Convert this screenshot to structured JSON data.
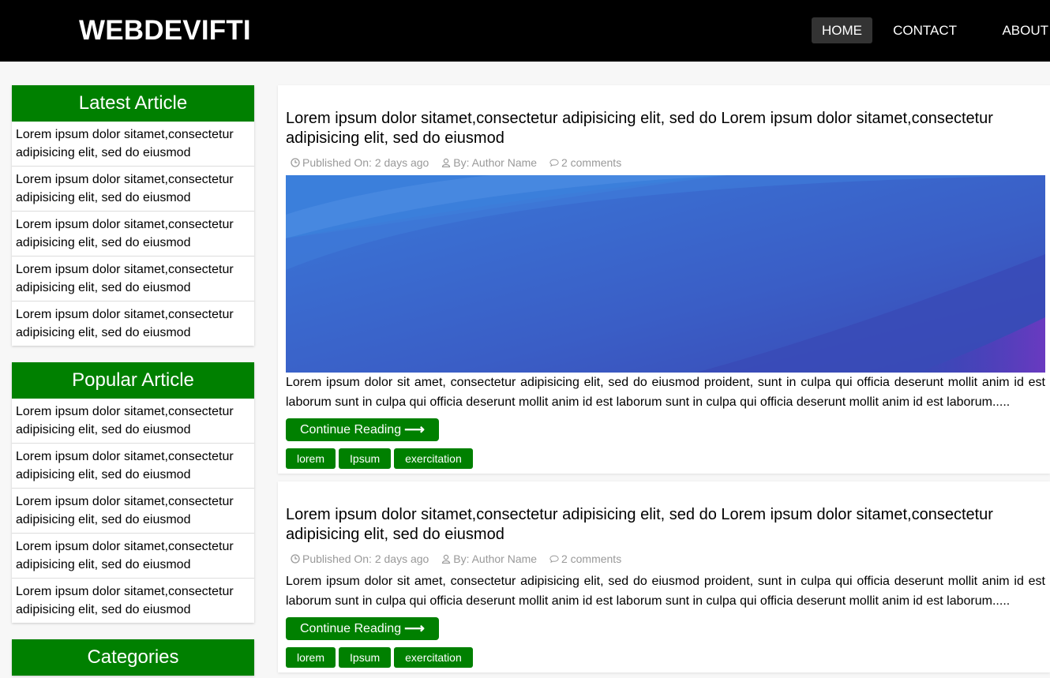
{
  "header": {
    "logo": "WEBDEVIFTI",
    "nav": [
      {
        "label": "HOME",
        "active": true
      },
      {
        "label": "CONTACT",
        "active": false
      },
      {
        "label": "ABOUT",
        "active": false
      }
    ]
  },
  "sidebar": {
    "latest": {
      "title": "Latest Article",
      "items": [
        "Lorem ipsum dolor sitamet,consectetur adipisicing elit, sed do eiusmod",
        "Lorem ipsum dolor sitamet,consectetur adipisicing elit, sed do eiusmod",
        "Lorem ipsum dolor sitamet,consectetur adipisicing elit, sed do eiusmod",
        "Lorem ipsum dolor sitamet,consectetur adipisicing elit, sed do eiusmod",
        "Lorem ipsum dolor sitamet,consectetur adipisicing elit, sed do eiusmod"
      ]
    },
    "popular": {
      "title": "Popular Article",
      "items": [
        "Lorem ipsum dolor sitamet,consectetur adipisicing elit, sed do eiusmod",
        "Lorem ipsum dolor sitamet,consectetur adipisicing elit, sed do eiusmod",
        "Lorem ipsum dolor sitamet,consectetur adipisicing elit, sed do eiusmod",
        "Lorem ipsum dolor sitamet,consectetur adipisicing elit, sed do eiusmod",
        "Lorem ipsum dolor sitamet,consectetur adipisicing elit, sed do eiusmod"
      ]
    },
    "categories": {
      "title": "Categories"
    }
  },
  "posts": [
    {
      "title": "Lorem ipsum dolor sitamet,consectetur adipisicing elit, sed do Lorem ipsum dolor sitamet,consectetur adipisicing elit, sed do eiusmod",
      "published": "Published On: 2 days ago",
      "author": "By: Author Name",
      "comments": "2 comments",
      "has_image": true,
      "excerpt": "Lorem ipsum dolor sit amet, consectetur adipisicing elit, sed do eiusmod proident, sunt in culpa qui officia deserunt mollit anim id est laborum sunt in culpa qui officia deserunt mollit anim id est laborum sunt in culpa qui officia deserunt mollit anim id est laborum.....",
      "button": "Continue Reading",
      "tags": [
        "lorem",
        "Ipsum",
        "exercitation"
      ]
    },
    {
      "title": "Lorem ipsum dolor sitamet,consectetur adipisicing elit, sed do Lorem ipsum dolor sitamet,consectetur adipisicing elit, sed do eiusmod",
      "published": "Published On: 2 days ago",
      "author": "By: Author Name",
      "comments": "2 comments",
      "has_image": false,
      "excerpt": "Lorem ipsum dolor sit amet, consectetur adipisicing elit, sed do eiusmod proident, sunt in culpa qui officia deserunt mollit anim id est laborum sunt in culpa qui officia deserunt mollit anim id est laborum sunt in culpa qui officia deserunt mollit anim id est laborum.....",
      "button": "Continue Reading",
      "tags": [
        "lorem",
        "Ipsum",
        "exercitation"
      ]
    }
  ],
  "colors": {
    "accent": "#008000",
    "topbar": "#000000",
    "nav_active": "#333333",
    "meta_text": "#999999"
  },
  "icons": {
    "published": "clock-icon",
    "author": "user-icon",
    "comments": "comment-icon",
    "button_arrow": "arrow-right-icon"
  }
}
